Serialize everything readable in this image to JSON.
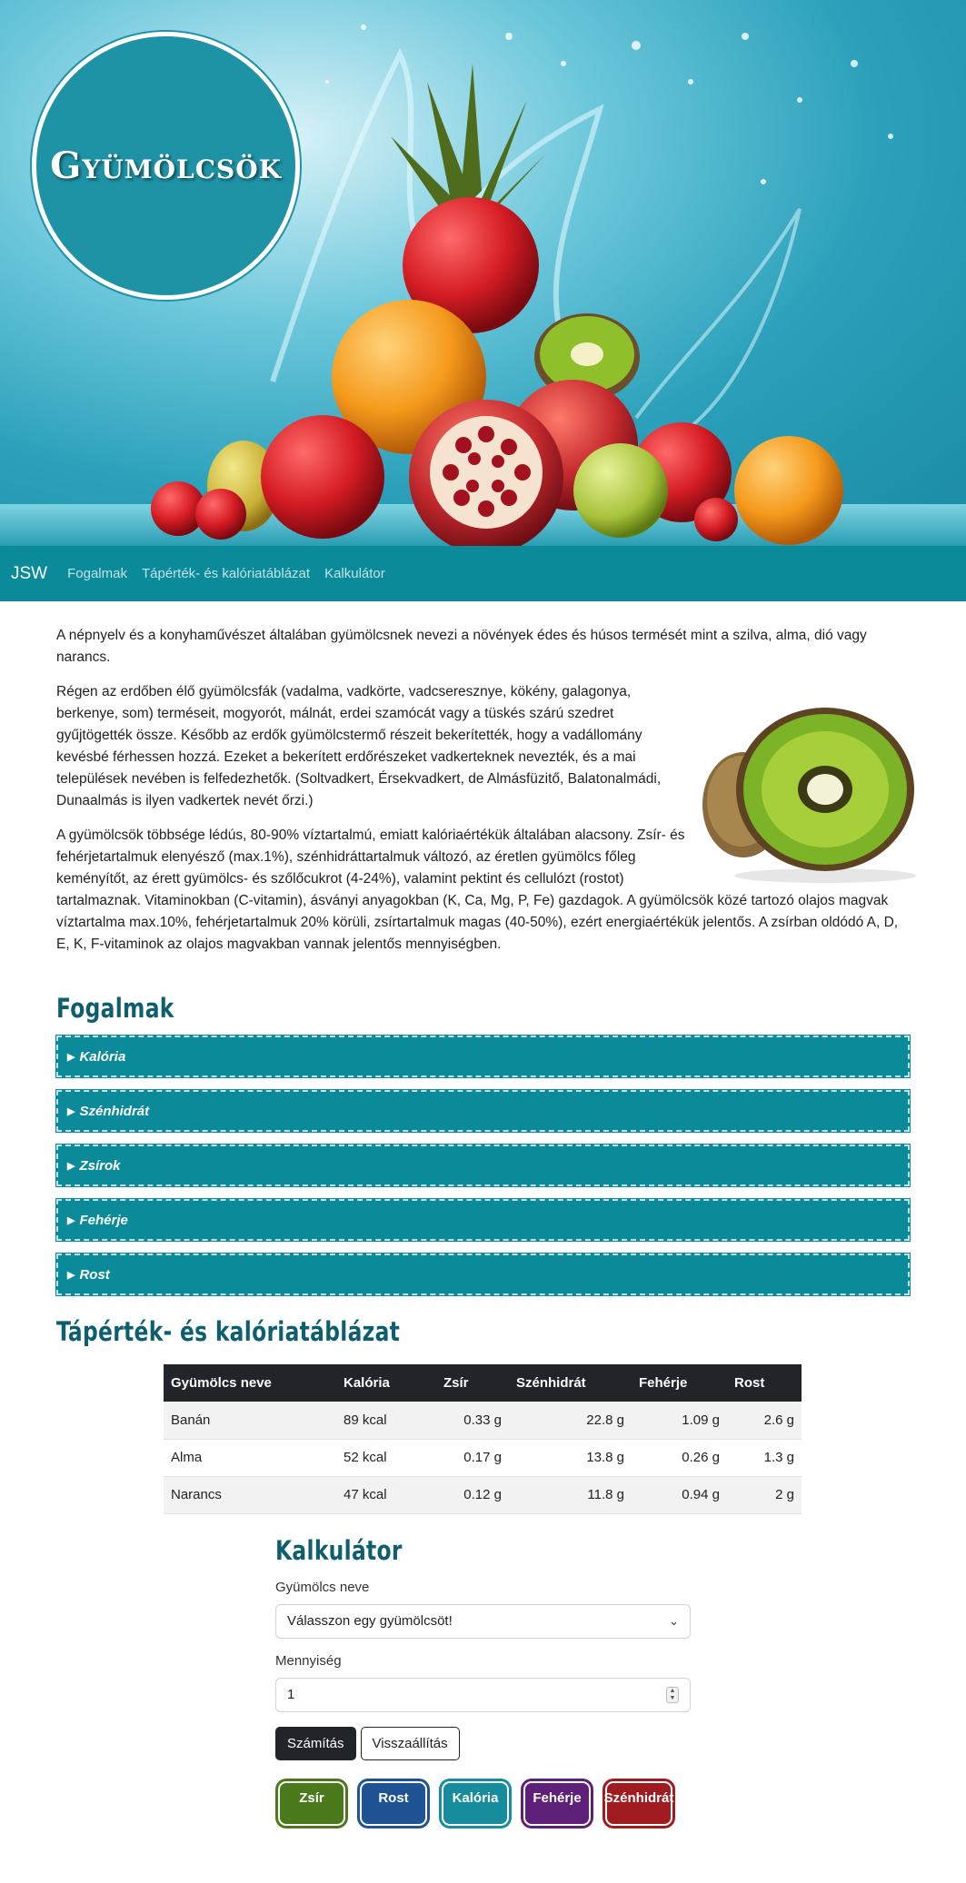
{
  "hero": {
    "title": "Gyümölcsök"
  },
  "nav": {
    "brand": "JSW",
    "links": [
      "Fogalmak",
      "Tápérték- és kalóriatáblázat",
      "Kalkulátor"
    ]
  },
  "intro": {
    "paragraphs": [
      "A népnyelv és a konyhaművészet általában gyümölcsnek nevezi a növények édes és húsos termését mint a szilva, alma, dió vagy narancs.",
      "Régen az erdőben élő gyümölcsfák (vadalma, vadkörte, vadcseresznye, kökény, galagonya, berkenye, som) terméseit, mogyorót, málnát, erdei szamócát vagy a tüskés szárú szedret gyűjtögették össze. Később az erdők gyümölcstermő részeit bekerítették, hogy a vadállomány kevésbé férhessen hozzá. Ezeket a bekerített erdőrészeket vadkerteknek nevezték, és a mai települések nevében is felfedezhetők. (Soltvadkert, Érsekvadkert, de Almásfüzitő, Balatonalmádi, Dunaalmás is ilyen vadkertek nevét őrzi.)",
      "A gyümölcsök többsége lédús, 80-90% víztartalmú, emiatt kalóriaértékük általában alacsony. Zsír- és fehérjetartalmuk elenyésző (max.1%), szénhidráttartalmuk változó, az éretlen gyümölcs főleg keményítőt, az érett gyümölcs- és szőlőcukrot (4-24%), valamint pektint és cellulózt (rostot) tartalmaznak. Vitaminokban (C-vitamin), ásványi anyagokban (K, Ca, Mg, P, Fe) gazdagok. A gyümölcsök közé tartozó olajos magvak víztartalma max.10%, fehérjetartalmuk 20% körüli, zsírtartalmuk magas (40-50%), ezért energiaértékük jelentős. A zsírban oldódó A, D, E, K, F-vitaminok az olajos magvakban vannak jelentős mennyiségben."
    ]
  },
  "concepts": {
    "heading": "Fogalmak",
    "items": [
      "Kalória",
      "Szénhidrát",
      "Zsírok",
      "Fehérje",
      "Rost"
    ]
  },
  "table": {
    "heading": "Tápérték- és kalóriatáblázat",
    "columns": [
      "Gyümölcs neve",
      "Kalória",
      "Zsír",
      "Szénhidrát",
      "Fehérje",
      "Rost"
    ],
    "rows": [
      [
        "Banán",
        "89 kcal",
        "0.33 g",
        "22.8 g",
        "1.09 g",
        "2.6 g"
      ],
      [
        "Alma",
        "52 kcal",
        "0.17 g",
        "13.8 g",
        "0.26 g",
        "1.3 g"
      ],
      [
        "Narancs",
        "47 kcal",
        "0.12 g",
        "11.8 g",
        "0.94 g",
        "2 g"
      ]
    ]
  },
  "calculator": {
    "heading": "Kalkulátor",
    "fruit_label": "Gyümölcs neve",
    "fruit_select_value": "Válasszon egy gyümölcsöt!",
    "amount_label": "Mennyiség",
    "amount_value": "1",
    "calculate_button": "Számítás",
    "reset_button": "Visszaállítás",
    "chips": [
      {
        "label": "Zsír",
        "color": "#4a7a1c"
      },
      {
        "label": "Rost",
        "color": "#1f5394"
      },
      {
        "label": "Kalória",
        "color": "#168c9c"
      },
      {
        "label": "Fehérje",
        "color": "#5e1f78"
      },
      {
        "label": "Szénhidrát",
        "color": "#a01b1f"
      }
    ]
  }
}
